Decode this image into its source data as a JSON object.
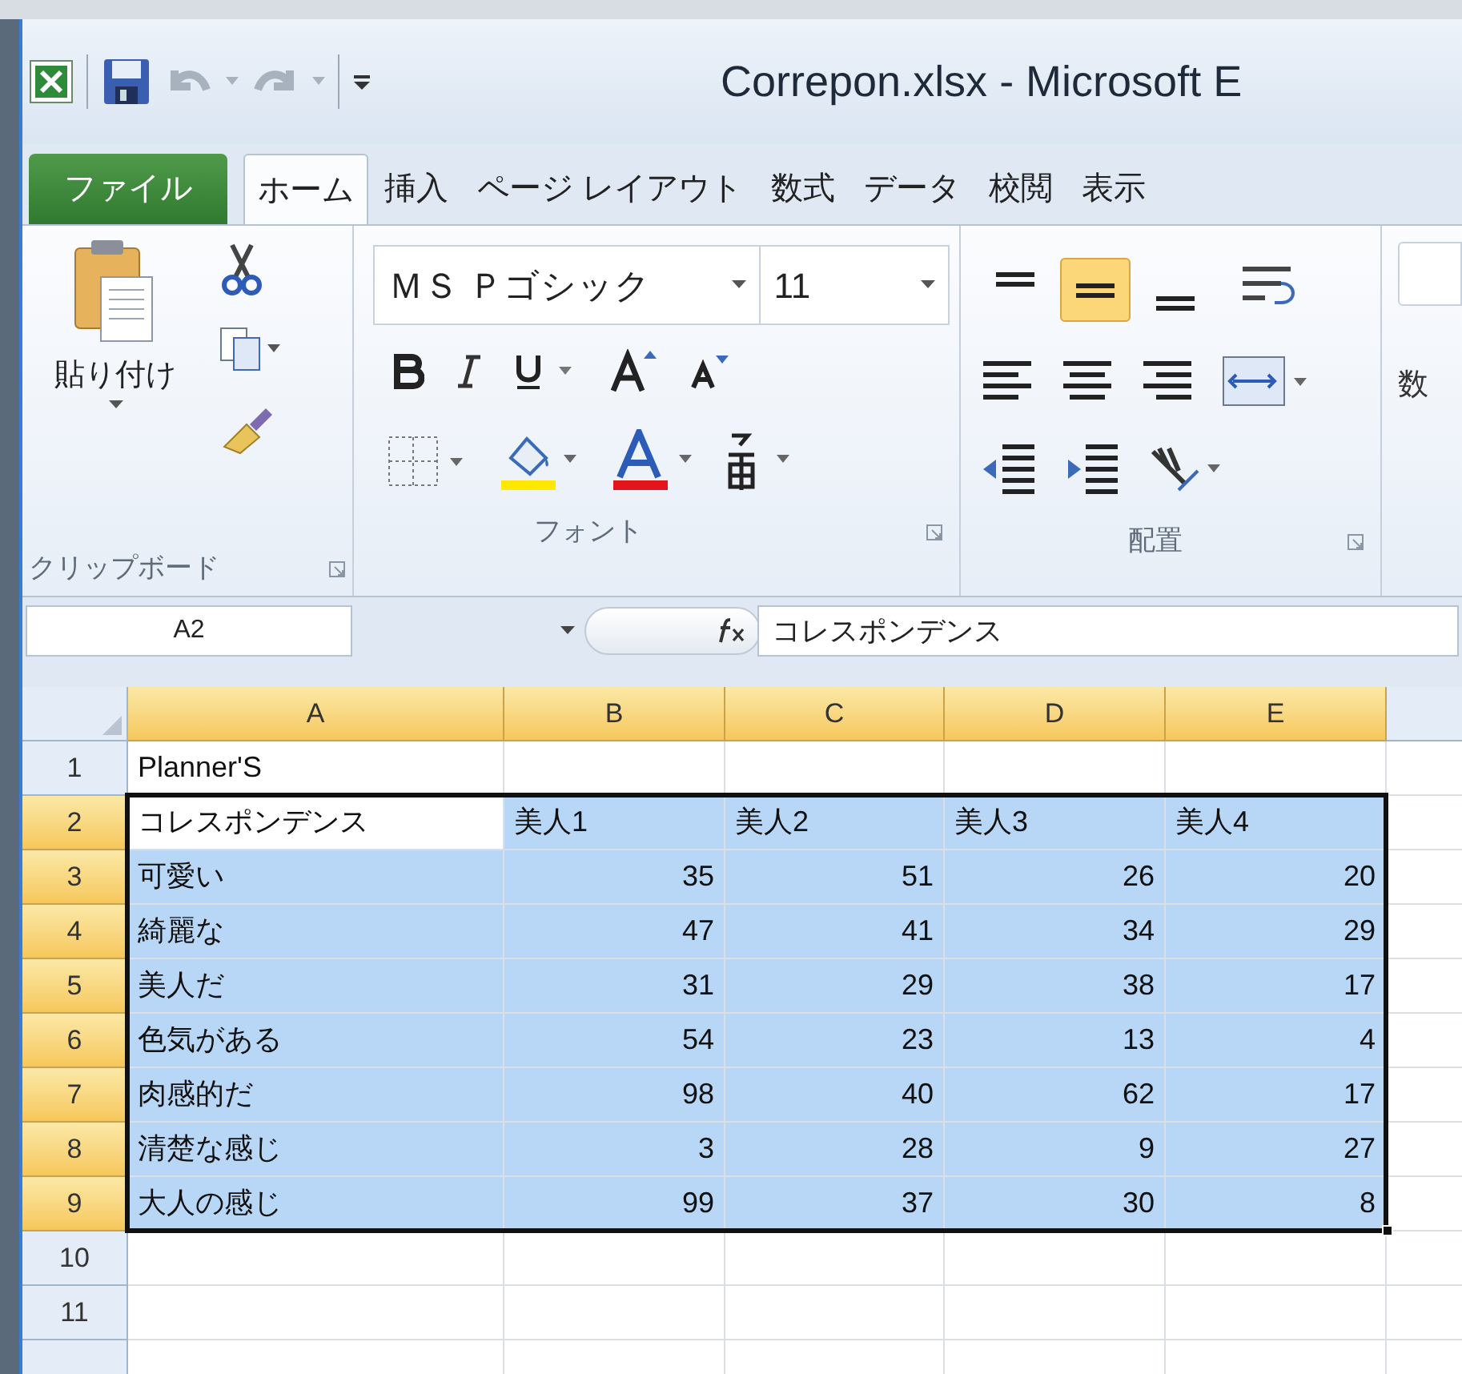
{
  "title_bar": {
    "title": "Correpon.xlsx - Microsoft E"
  },
  "tabs": [
    {
      "label": "ファイル",
      "kind": "file",
      "selected": false
    },
    {
      "label": "ホーム",
      "kind": "tab",
      "selected": true
    },
    {
      "label": "挿入",
      "kind": "tab",
      "selected": false
    },
    {
      "label": "ページ レイアウト",
      "kind": "tab",
      "selected": false
    },
    {
      "label": "数式",
      "kind": "tab",
      "selected": false
    },
    {
      "label": "データ",
      "kind": "tab",
      "selected": false
    },
    {
      "label": "校閲",
      "kind": "tab",
      "selected": false
    },
    {
      "label": "表示",
      "kind": "tab",
      "selected": false
    }
  ],
  "ribbon": {
    "clipboard": {
      "paste_label": "貼り付け",
      "label": "クリップボード"
    },
    "font": {
      "font_name": "ＭＳ Ｐゴシック",
      "font_size": "11",
      "label": "フォント"
    },
    "alignment": {
      "label": "配置",
      "vertical": [
        {
          "selected": false
        },
        {
          "selected": true
        },
        {
          "selected": false
        }
      ]
    },
    "number": {
      "label": "数"
    }
  },
  "formula_bar": {
    "name_box": "A2",
    "formula": "コレスポンデンス"
  },
  "sheet": {
    "columns": [
      {
        "label": "A",
        "selected": true
      },
      {
        "label": "B",
        "selected": true
      },
      {
        "label": "C",
        "selected": true
      },
      {
        "label": "D",
        "selected": true
      },
      {
        "label": "E",
        "selected": true
      }
    ],
    "rows": [
      {
        "number": "1",
        "kind": "label",
        "selected": false,
        "cells": [
          {
            "text": "Planner'S",
            "active": false
          }
        ]
      },
      {
        "number": "2",
        "kind": "header",
        "selected": true,
        "cells": [
          {
            "text": "コレスポンデンス",
            "active": true
          },
          {
            "text": "美人1",
            "active": false
          },
          {
            "text": "美人2",
            "active": false
          },
          {
            "text": "美人3",
            "active": false
          },
          {
            "text": "美人4",
            "active": false
          }
        ]
      },
      {
        "number": "3",
        "kind": "values",
        "selected": true,
        "cells": [
          {
            "text": "可愛い",
            "active": false
          },
          {
            "text": "35",
            "active": false
          },
          {
            "text": "51",
            "active": false
          },
          {
            "text": "26",
            "active": false
          },
          {
            "text": "20",
            "active": false
          }
        ]
      },
      {
        "number": "4",
        "kind": "values",
        "selected": true,
        "cells": [
          {
            "text": "綺麗な",
            "active": false
          },
          {
            "text": "47",
            "active": false
          },
          {
            "text": "41",
            "active": false
          },
          {
            "text": "34",
            "active": false
          },
          {
            "text": "29",
            "active": false
          }
        ]
      },
      {
        "number": "5",
        "kind": "values",
        "selected": true,
        "cells": [
          {
            "text": "美人だ",
            "active": false
          },
          {
            "text": "31",
            "active": false
          },
          {
            "text": "29",
            "active": false
          },
          {
            "text": "38",
            "active": false
          },
          {
            "text": "17",
            "active": false
          }
        ]
      },
      {
        "number": "6",
        "kind": "values",
        "selected": true,
        "cells": [
          {
            "text": "色気がある",
            "active": false
          },
          {
            "text": "54",
            "active": false
          },
          {
            "text": "23",
            "active": false
          },
          {
            "text": "13",
            "active": false
          },
          {
            "text": "4",
            "active": false
          }
        ]
      },
      {
        "number": "7",
        "kind": "values",
        "selected": true,
        "cells": [
          {
            "text": "肉感的だ",
            "active": false
          },
          {
            "text": "98",
            "active": false
          },
          {
            "text": "40",
            "active": false
          },
          {
            "text": "62",
            "active": false
          },
          {
            "text": "17",
            "active": false
          }
        ]
      },
      {
        "number": "8",
        "kind": "values",
        "selected": true,
        "cells": [
          {
            "text": "清楚な感じ",
            "active": false
          },
          {
            "text": "3",
            "active": false
          },
          {
            "text": "28",
            "active": false
          },
          {
            "text": "9",
            "active": false
          },
          {
            "text": "27",
            "active": false
          }
        ]
      },
      {
        "number": "9",
        "kind": "values",
        "selected": true,
        "cells": [
          {
            "text": "大人の感じ",
            "active": false
          },
          {
            "text": "99",
            "active": false
          },
          {
            "text": "37",
            "active": false
          },
          {
            "text": "30",
            "active": false
          },
          {
            "text": "8",
            "active": false
          }
        ]
      },
      {
        "number": "10",
        "kind": "empty",
        "selected": false,
        "cells": []
      },
      {
        "number": "11",
        "kind": "empty",
        "selected": false,
        "cells": []
      }
    ]
  }
}
